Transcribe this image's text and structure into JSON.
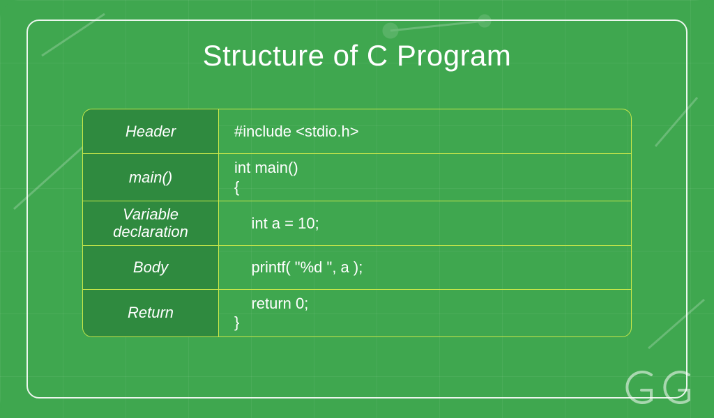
{
  "title": "Structure of C Program",
  "rows": [
    {
      "label": "Header",
      "code": [
        "#include <stdio.h>"
      ]
    },
    {
      "label": "main()",
      "code": [
        "int main()",
        "{"
      ]
    },
    {
      "label": "Variable declaration",
      "code": [
        "    int a = 10;"
      ]
    },
    {
      "label": "Body",
      "code": [
        "    printf( \"%d \", a );"
      ]
    },
    {
      "label": "Return",
      "code": [
        "    return 0;",
        "}"
      ]
    }
  ],
  "logo_text": "GG",
  "colors": {
    "background": "#3fa74f",
    "label_bg": "#2f8a3f",
    "border": "#c9e84a",
    "text": "#ffffff"
  }
}
